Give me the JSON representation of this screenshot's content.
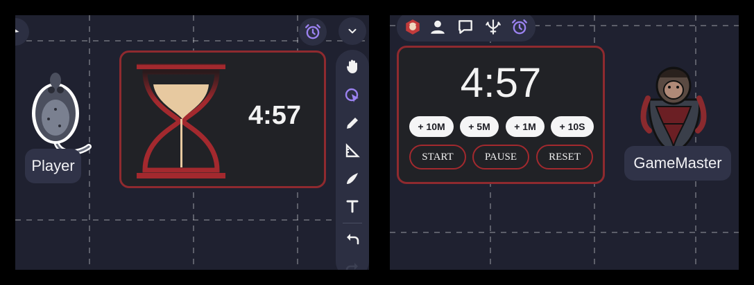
{
  "player_view": {
    "player": {
      "name": "Player"
    },
    "timer": {
      "time": "4:57"
    },
    "header": {
      "alarm_icon": "alarm-clock-icon",
      "collapse_icon": "chevron-down-icon"
    },
    "toolbar": {
      "tools": [
        "hand-icon",
        "pointer-icon",
        "pencil-icon",
        "ruler-icon",
        "brush-icon",
        "text-icon",
        "undo-icon",
        "redo-icon"
      ]
    }
  },
  "gm_view": {
    "top_bar": {
      "icons": [
        "extension-logo-icon",
        "user-icon",
        "chat-icon",
        "trident-icon",
        "alarm-clock-icon"
      ]
    },
    "timer": {
      "time": "4:57",
      "add_buttons": [
        "+ 10M",
        "+ 5M",
        "+ 1M",
        "+ 10S"
      ],
      "controls": [
        "START",
        "PAUSE",
        "RESET"
      ]
    },
    "gamemaster": {
      "name": "GameMaster"
    }
  },
  "colors": {
    "background": "#1f2130",
    "card_border": "#8f2a2f",
    "card_bg": "#212226",
    "accent_purple": "#9b82f0",
    "sand": "#e7c9a0",
    "hourglass_red": "#a3292e"
  }
}
